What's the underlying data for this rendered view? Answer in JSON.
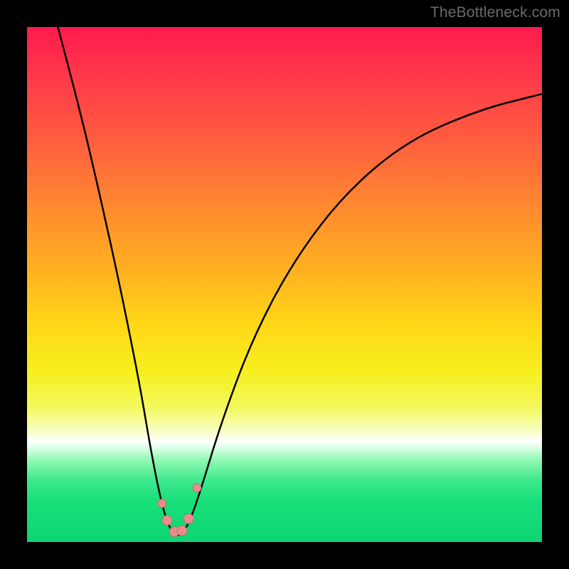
{
  "watermark": "TheBottleneck.com",
  "colors": {
    "background": "#000000",
    "gradient_top": "#ff1a4e",
    "gradient_bottom": "#0cd571",
    "curve": "#000000",
    "marker": "#e88c8c"
  },
  "chart_data": {
    "type": "line",
    "title": "",
    "xlabel": "",
    "ylabel": "",
    "xlim": [
      0,
      100
    ],
    "ylim": [
      0,
      100
    ],
    "note": "Bottleneck-style V-curve on a gradient background. Axes and ticks are hidden in the source image; x/y values are estimated from pixel positions where y=0 is the bottom (ideal/green) and y=100 is the top (worst/red).",
    "series": [
      {
        "name": "bottleneck-curve",
        "x": [
          6,
          10,
          14,
          18,
          22,
          24,
          26,
          27.5,
          29,
          30.5,
          32,
          34,
          38,
          44,
          52,
          62,
          74,
          88,
          100
        ],
        "y": [
          100,
          85,
          68,
          50,
          30,
          18,
          8,
          3,
          1,
          2,
          5,
          11,
          24,
          40,
          55,
          68,
          78,
          84,
          87
        ]
      }
    ],
    "markers": [
      {
        "x": 26.2,
        "y": 7.5,
        "r": 6
      },
      {
        "x": 27.2,
        "y": 4.2,
        "r": 7
      },
      {
        "x": 28.6,
        "y": 2.0,
        "r": 7
      },
      {
        "x": 30.1,
        "y": 2.2,
        "r": 7
      },
      {
        "x": 31.4,
        "y": 4.5,
        "r": 7
      },
      {
        "x": 33.0,
        "y": 10.5,
        "r": 6
      }
    ]
  }
}
